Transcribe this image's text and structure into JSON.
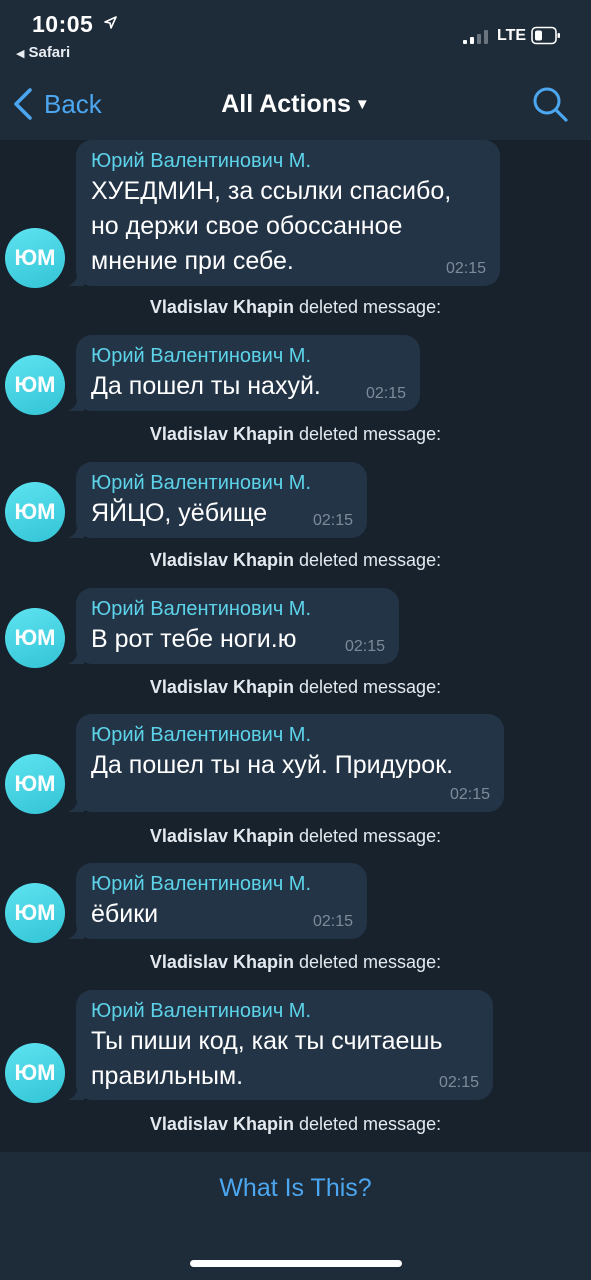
{
  "status_bar": {
    "time": "10:05",
    "back_app": "Safari",
    "network": "LTE"
  },
  "nav": {
    "back_label": "Back",
    "title": "All Actions"
  },
  "messages": [
    {
      "initials": "ЮМ",
      "sender": "Юрий Валентинович М.",
      "lines": [
        "ХУЕДМИН, за ссылки спасибо,",
        "но держи свое обоссанное",
        "мнение при себе."
      ],
      "time": "02:15"
    },
    {
      "initials": "ЮМ",
      "sender": "Юрий Валентинович М.",
      "lines": [
        "Да пошел ты нахуй."
      ],
      "time": "02:15"
    },
    {
      "initials": "ЮМ",
      "sender": "Юрий Валентинович М.",
      "lines": [
        "ЯЙЦО, уёбище"
      ],
      "time": "02:15"
    },
    {
      "initials": "ЮМ",
      "sender": "Юрий Валентинович М.",
      "lines": [
        "В рот тебе ноги.ю"
      ],
      "time": "02:15"
    },
    {
      "initials": "ЮМ",
      "sender": "Юрий Валентинович М.",
      "lines": [
        "Да пошел ты на хуй. Придурок."
      ],
      "time": "02:15"
    },
    {
      "initials": "ЮМ",
      "sender": "Юрий Валентинович М.",
      "lines": [
        "ёбики"
      ],
      "time": "02:15"
    },
    {
      "initials": "ЮМ",
      "sender": "Юрий Валентинович М.",
      "lines": [
        "Ты пиши код, как ты считаешь",
        "правильным."
      ],
      "time": "02:15"
    }
  ],
  "action_text": {
    "actor": "Vladislav Khapin",
    "verb": "deleted message:"
  },
  "bottom": {
    "button_label": "What Is This?"
  },
  "colors": {
    "background": "#18222d",
    "bar": "#1e2b38",
    "bubble": "#243447",
    "accent": "#4ca7f0",
    "sender": "#5dd3e9",
    "avatar": "#44d0e0"
  }
}
